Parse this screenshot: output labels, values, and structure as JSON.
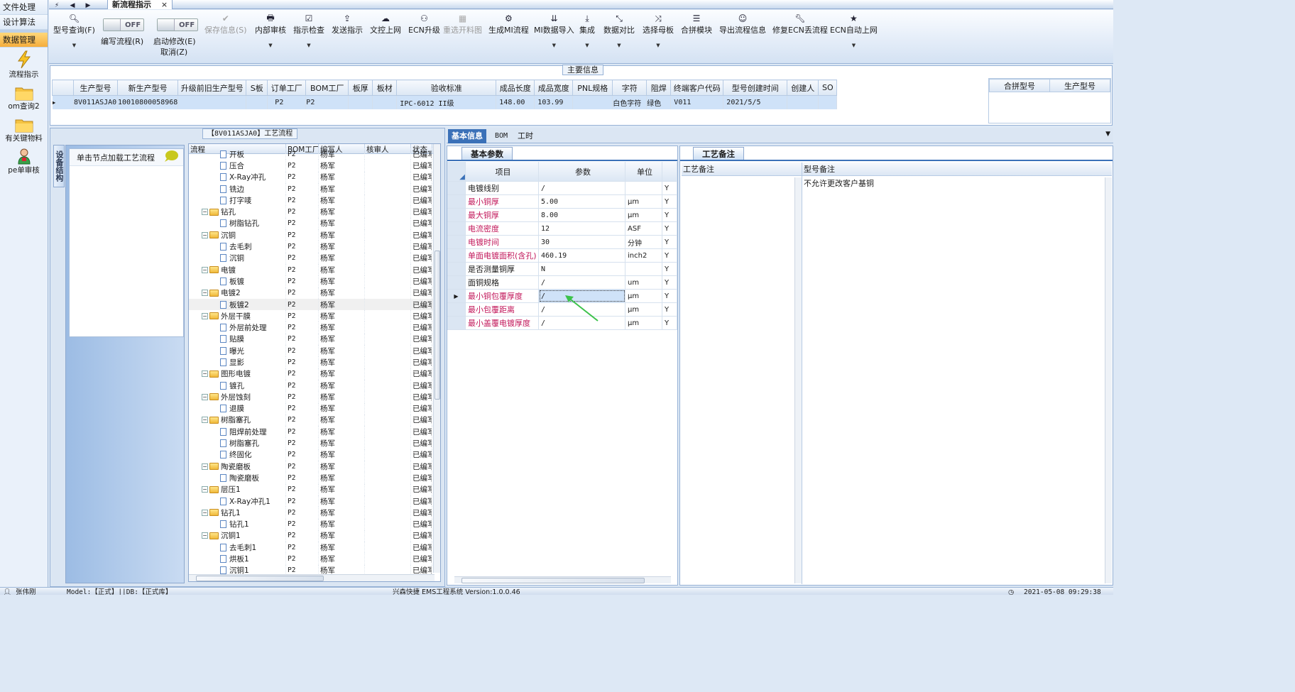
{
  "nav": {
    "items": [
      "文件处理",
      "设计算法",
      "数据管理"
    ],
    "apps": [
      {
        "label": "流程指示",
        "icon": "lightning-icon"
      },
      {
        "label": "om查询2",
        "icon": "folder-icon"
      },
      {
        "label": "有关键物料",
        "icon": "folder-icon"
      },
      {
        "label": "pe单审核",
        "icon": "user-icon"
      }
    ]
  },
  "tabs": {
    "doc_title": "新流程指示",
    "close": "×"
  },
  "toolbar": {
    "query": "型号查询(F)",
    "edit_flow": "编写流程(R)",
    "start_edit": "启动修改(E)",
    "cancel": "取消(Z)",
    "off1": "OFF",
    "off2": "OFF",
    "save": "保存信息(S)",
    "internal_review": "内部审核",
    "indicator_check": "指示检查",
    "send": "发送指示",
    "doc_upload": "文控上网",
    "ecn_upgrade": "ECN升级",
    "reselect": "重选开料图",
    "gen_mi": "生成MI流程",
    "mi_import": "MI数据导入",
    "integrate": "集成",
    "compare": "数据对比",
    "select_mother": "选择母板",
    "merge": "合拼模块",
    "export_flow": "导出流程信息",
    "repair_ecn": "修复ECN丢流程",
    "ecn_auto": "ECN自动上网"
  },
  "main_info": {
    "title": "主要信息",
    "columns": [
      "生产型号",
      "新生产型号",
      "升级前旧生产型号",
      "S板",
      "订单工厂",
      "BOM工厂",
      "板厚",
      "板材",
      "验收标准",
      "成品长度",
      "成品宽度",
      "PNL规格",
      "字符",
      "阻焊",
      "终端客户代码",
      "型号创建时间",
      "创建人",
      "SO"
    ],
    "row": [
      "8V011ASJA0",
      "10010800058968",
      "",
      "",
      "P2",
      "P2",
      "",
      "",
      "IPC-6012 II级",
      "148.00",
      "103.99",
      "",
      "白色字符",
      "绿色",
      "V011",
      "2021/5/5",
      "",
      ""
    ],
    "merge_columns": [
      "合拼型号",
      "生产型号"
    ]
  },
  "flow": {
    "title": "【8V011ASJA0】工艺流程",
    "vtab": "设备结构",
    "hint": "单击节点加载工艺流程",
    "columns": [
      "流程",
      "BOM工厂",
      "编写人",
      "核审人",
      "状态"
    ],
    "rows": [
      {
        "name": "开板",
        "lvl": 2,
        "f": "P2",
        "w": "杨军",
        "s": "已编写"
      },
      {
        "name": "压合",
        "lvl": 2,
        "f": "P2",
        "w": "杨军",
        "s": "已编写"
      },
      {
        "name": "X-Ray冲孔",
        "lvl": 2,
        "f": "P2",
        "w": "杨军",
        "s": "已编写"
      },
      {
        "name": "铣边",
        "lvl": 2,
        "f": "P2",
        "w": "杨军",
        "s": "已编写"
      },
      {
        "name": "打字唛",
        "lvl": 2,
        "f": "P2",
        "w": "杨军",
        "s": "已编写"
      },
      {
        "name": "钻孔",
        "lvl": 1,
        "f": "P2",
        "w": "杨军",
        "s": "已编写"
      },
      {
        "name": "树脂钻孔",
        "lvl": 2,
        "f": "P2",
        "w": "杨军",
        "s": "已编写"
      },
      {
        "name": "沉铜",
        "lvl": 1,
        "f": "P2",
        "w": "杨军",
        "s": "已编写"
      },
      {
        "name": "去毛刺",
        "lvl": 2,
        "f": "P2",
        "w": "杨军",
        "s": "已编写"
      },
      {
        "name": "沉铜",
        "lvl": 2,
        "f": "P2",
        "w": "杨军",
        "s": "已编写"
      },
      {
        "name": "电镀",
        "lvl": 1,
        "f": "P2",
        "w": "杨军",
        "s": "已编写"
      },
      {
        "name": "板镀",
        "lvl": 2,
        "f": "P2",
        "w": "杨军",
        "s": "已编写"
      },
      {
        "name": "电镀2",
        "lvl": 1,
        "f": "P2",
        "w": "杨军",
        "s": "已编写"
      },
      {
        "name": "板镀2",
        "lvl": 2,
        "f": "P2",
        "w": "杨军",
        "s": "已编写",
        "hl": true
      },
      {
        "name": "外层干膜",
        "lvl": 1,
        "f": "P2",
        "w": "杨军",
        "s": "已编写"
      },
      {
        "name": "外层前处理",
        "lvl": 2,
        "f": "P2",
        "w": "杨军",
        "s": "已编写"
      },
      {
        "name": "贴膜",
        "lvl": 2,
        "f": "P2",
        "w": "杨军",
        "s": "已编写"
      },
      {
        "name": "曝光",
        "lvl": 2,
        "f": "P2",
        "w": "杨军",
        "s": "已编写"
      },
      {
        "name": "显影",
        "lvl": 2,
        "f": "P2",
        "w": "杨军",
        "s": "已编写"
      },
      {
        "name": "图形电镀",
        "lvl": 1,
        "f": "P2",
        "w": "杨军",
        "s": "已编写"
      },
      {
        "name": "镀孔",
        "lvl": 2,
        "f": "P2",
        "w": "杨军",
        "s": "已编写"
      },
      {
        "name": "外层蚀刻",
        "lvl": 1,
        "f": "P2",
        "w": "杨军",
        "s": "已编写"
      },
      {
        "name": "退膜",
        "lvl": 2,
        "f": "P2",
        "w": "杨军",
        "s": "已编写"
      },
      {
        "name": "树脂塞孔",
        "lvl": 1,
        "f": "P2",
        "w": "杨军",
        "s": "已编写"
      },
      {
        "name": "阻焊前处理",
        "lvl": 2,
        "f": "P2",
        "w": "杨军",
        "s": "已编写"
      },
      {
        "name": "树脂塞孔",
        "lvl": 2,
        "f": "P2",
        "w": "杨军",
        "s": "已编写"
      },
      {
        "name": "终固化",
        "lvl": 2,
        "f": "P2",
        "w": "杨军",
        "s": "已编写"
      },
      {
        "name": "陶瓷磨板",
        "lvl": 1,
        "f": "P2",
        "w": "杨军",
        "s": "已编写"
      },
      {
        "name": "陶瓷磨板",
        "lvl": 2,
        "f": "P2",
        "w": "杨军",
        "s": "已编写"
      },
      {
        "name": "层压1",
        "lvl": 1,
        "f": "P2",
        "w": "杨军",
        "s": "已编写"
      },
      {
        "name": "X-Ray冲孔1",
        "lvl": 2,
        "f": "P2",
        "w": "杨军",
        "s": "已编写"
      },
      {
        "name": "钻孔1",
        "lvl": 1,
        "f": "P2",
        "w": "杨军",
        "s": "已编写"
      },
      {
        "name": "钻孔1",
        "lvl": 2,
        "f": "P2",
        "w": "杨军",
        "s": "已编写"
      },
      {
        "name": "沉铜1",
        "lvl": 1,
        "f": "P2",
        "w": "杨军",
        "s": "已编写"
      },
      {
        "name": "去毛刺1",
        "lvl": 2,
        "f": "P2",
        "w": "杨军",
        "s": "已编写"
      },
      {
        "name": "烘板1",
        "lvl": 2,
        "f": "P2",
        "w": "杨军",
        "s": "已编写"
      },
      {
        "name": "沉铜1",
        "lvl": 2,
        "f": "P2",
        "w": "杨军",
        "s": "已编写"
      }
    ]
  },
  "right_tabs": [
    "基本信息",
    "BOM",
    "工时"
  ],
  "params": {
    "section": "基本参数",
    "columns": [
      "项目",
      "参数",
      "单位"
    ],
    "rows": [
      {
        "item": "电镀线别",
        "val": "/",
        "unit": "",
        "y": "Y",
        "red": false
      },
      {
        "item": "最小铜厚",
        "val": "5.00",
        "unit": "μm",
        "y": "Y",
        "red": true
      },
      {
        "item": "最大铜厚",
        "val": "8.00",
        "unit": "μm",
        "y": "Y",
        "red": true
      },
      {
        "item": "电流密度",
        "val": "12",
        "unit": "ASF",
        "y": "Y",
        "red": true
      },
      {
        "item": "电镀时间",
        "val": "30",
        "unit": "分钟",
        "y": "Y",
        "red": true
      },
      {
        "item": "单面电镀面积(含孔)",
        "val": "460.19",
        "unit": "inch2",
        "y": "Y",
        "red": true
      },
      {
        "item": "是否测量铜厚",
        "val": "N",
        "unit": "",
        "y": "Y",
        "red": false
      },
      {
        "item": "面铜规格",
        "val": "/",
        "unit": "um",
        "y": "Y",
        "red": false
      },
      {
        "item": "最小铜包覆厚度",
        "val": "/",
        "unit": "μm",
        "y": "Y",
        "red": true,
        "sel": true
      },
      {
        "item": "最小包覆距离",
        "val": "/",
        "unit": "μm",
        "y": "Y",
        "red": true
      },
      {
        "item": "最小盖覆电镀厚度",
        "val": "/",
        "unit": "μm",
        "y": "Y",
        "red": true
      }
    ]
  },
  "remarks": {
    "section": "工艺备注",
    "col1": "工艺备注",
    "col2": "型号备注",
    "model_remark": "不允许更改客户基铜"
  },
  "status": {
    "user": "张伟刚",
    "mode": "Model:【正式】||DB:【正式库】",
    "system": "兴森快捷 EMS工程系统 Version:1.0.0.46",
    "time": "2021-05-08 09:29:38"
  },
  "colors": {
    "accent": "#3b71b8",
    "red_text": "#c2185b",
    "selection": "#cfe2f8"
  }
}
